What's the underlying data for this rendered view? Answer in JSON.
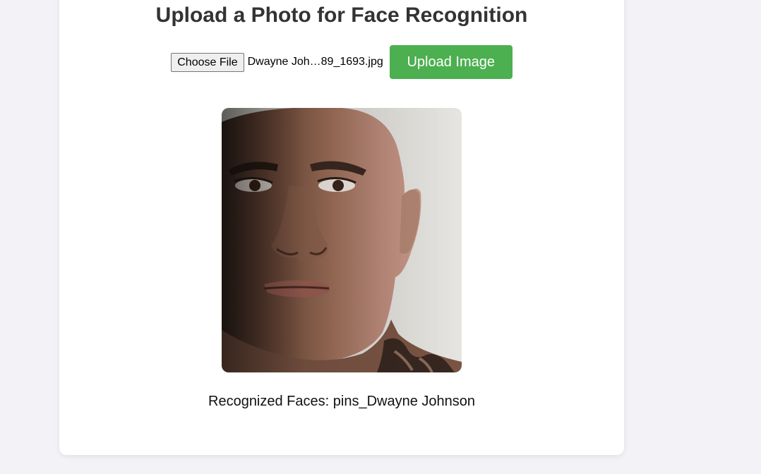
{
  "page": {
    "title": "Upload a Photo for Face Recognition"
  },
  "upload_form": {
    "choose_file_label": "Choose File",
    "selected_file_name": "Dwayne Joh…89_1693.jpg",
    "upload_button_label": "Upload Image"
  },
  "result": {
    "text": "Recognized Faces: pins_Dwayne Johnson"
  },
  "colors": {
    "page_background": "#f3f3f7",
    "card_background": "#ffffff",
    "upload_button": "#4caf50",
    "title_text": "#333333"
  },
  "image": {
    "subject": "face-portrait",
    "alt": "Uploaded photo"
  }
}
